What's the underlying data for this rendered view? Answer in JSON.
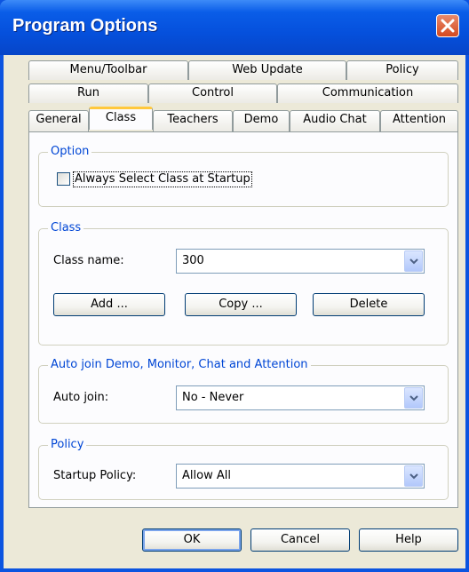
{
  "window": {
    "title": "Program Options"
  },
  "tabs": {
    "row1": [
      "Menu/Toolbar",
      "Web Update",
      "Policy"
    ],
    "row2": [
      "Run",
      "Control",
      "Communication"
    ],
    "row3": [
      "General",
      "Class",
      "Teachers",
      "Demo",
      "Audio Chat",
      "Attention"
    ],
    "active": "Class"
  },
  "option_group": {
    "title": "Option",
    "always_select_class": {
      "label": "Always Select Class at Startup",
      "checked": false
    }
  },
  "class_group": {
    "title": "Class",
    "class_name_label": "Class name:",
    "class_name_value": "300",
    "add_label": "Add ...",
    "copy_label": "Copy ...",
    "delete_label": "Delete"
  },
  "autojoin_group": {
    "title": "Auto join Demo, Monitor, Chat and Attention",
    "auto_join_label": "Auto join:",
    "auto_join_value": "No - Never"
  },
  "policy_group": {
    "title": "Policy",
    "startup_policy_label": "Startup Policy:",
    "startup_policy_value": "Allow All"
  },
  "footer": {
    "ok_label": "OK",
    "cancel_label": "Cancel",
    "help_label": "Help"
  },
  "colors": {
    "titlebar": "#0550dc",
    "accent_tab": "#ffc83c",
    "group_title": "#0046d5",
    "close": "#d4491f"
  }
}
